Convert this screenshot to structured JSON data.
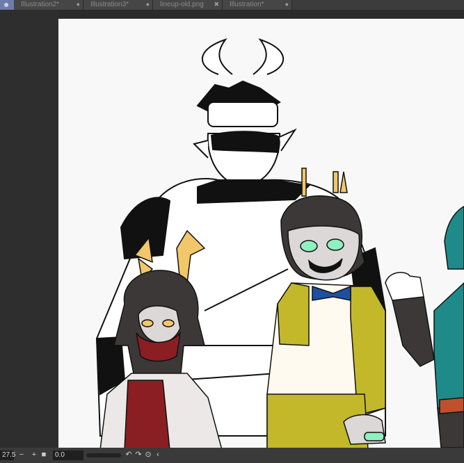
{
  "tabs": [
    {
      "label": "Illustration2*",
      "close_icon": "dot-icon"
    },
    {
      "label": "Illustration3*",
      "close_icon": "dot-icon"
    },
    {
      "label": "lineup-old.png",
      "close_icon": "x-icon"
    },
    {
      "label": "Illustration*",
      "close_icon": "dot-icon"
    }
  ],
  "status": {
    "zoom": "27.5",
    "zoom_out": "−",
    "zoom_in": "+",
    "angle": "0.0"
  },
  "colors": {
    "canvas": "#f8f8f8",
    "tab_accent": "#6d7da8",
    "horn_yellow": "#f2c76a",
    "red_shirt": "#8b1e22",
    "mustard": "#c2b82a",
    "teal": "#1e8a8a",
    "bowtie": "#1f4fa0",
    "green_eyes": "#8ff0c0",
    "skin_gray": "#dcd8d8"
  }
}
